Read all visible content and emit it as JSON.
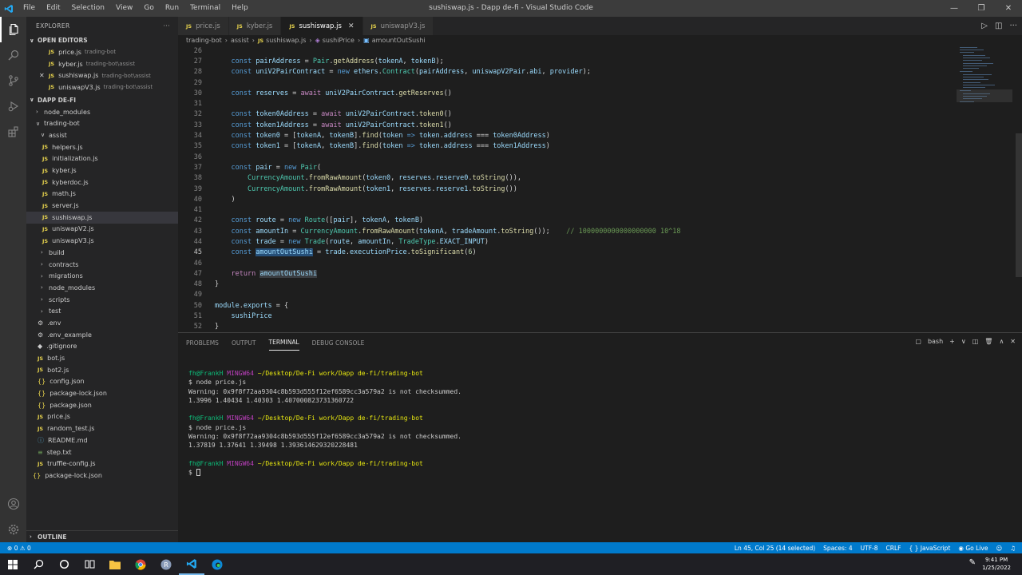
{
  "window": {
    "title": "sushiswap.js - Dapp de-fi - Visual Studio Code",
    "menu": [
      "File",
      "Edit",
      "Selection",
      "View",
      "Go",
      "Run",
      "Terminal",
      "Help"
    ]
  },
  "sidebar": {
    "title": "EXPLORER",
    "open_editors_label": "OPEN EDITORS",
    "open_editors": [
      {
        "name": "price.js",
        "path": "trading-bot"
      },
      {
        "name": "kyber.js",
        "path": "trading-bot\\assist"
      },
      {
        "name": "sushiswap.js",
        "path": "trading-bot\\assist"
      },
      {
        "name": "uniswapV3.js",
        "path": "trading-bot\\assist"
      }
    ],
    "project_label": "DAPP DE-FI",
    "tree": {
      "node_modules": "node_modules",
      "trading_bot": "trading-bot",
      "assist": "assist",
      "assist_files": [
        "helpers.js",
        "initialization.js",
        "kyber.js",
        "kyberdoc.js",
        "math.js",
        "server.js",
        "sushiswap.js",
        "uniswapV2.js",
        "uniswapV3.js"
      ],
      "folders": [
        "build",
        "contracts",
        "migrations",
        "node_modules",
        "scripts",
        "test"
      ],
      "files": {
        "env": ".env",
        "env_example": ".env_example",
        "gitignore": ".gitignore",
        "bot": "bot.js",
        "bot2": "bot2.js",
        "config": "config.json",
        "package_lock": "package-lock.json",
        "package": "package.json",
        "price": "price.js",
        "random_test": "random_test.js",
        "readme": "README.md",
        "step": "step.txt",
        "truffle": "truffle-config.js"
      },
      "root_package_lock": "package-lock.json"
    },
    "outline_label": "OUTLINE"
  },
  "tabs": [
    {
      "label": "price.js"
    },
    {
      "label": "kyber.js"
    },
    {
      "label": "sushiswap.js"
    },
    {
      "label": "uniswapV3.js"
    }
  ],
  "breadcrumb": [
    "trading-bot",
    "assist",
    "sushiswap.js",
    "sushiPrice",
    "amountOutSushi"
  ],
  "editor": {
    "line_numbers": [
      "26",
      "27",
      "28",
      "29",
      "30",
      "31",
      "32",
      "33",
      "34",
      "35",
      "36",
      "37",
      "38",
      "39",
      "40",
      "41",
      "42",
      "43",
      "44",
      "45",
      "46",
      "47",
      "48",
      "49",
      "50",
      "51",
      "52"
    ],
    "comment": "// 1000000000000000000 10^18",
    "number_0": "0",
    "number_1": "1",
    "number_6": "6"
  },
  "panel": {
    "tabs": [
      "PROBLEMS",
      "OUTPUT",
      "TERMINAL",
      "DEBUG CONSOLE"
    ],
    "shell": "bash",
    "prompt_user": "fh@FrankH",
    "prompt_host": "MINGW64",
    "prompt_path": "~/Desktop/De-Fi work/Dapp de-fi/trading-bot",
    "cmd": "$ node price.js",
    "warning": "Warning: 0x9f8f72aa9304c8b593d555f12ef6589cc3a579a2 is not checksummed.",
    "output1": "1.3996 1.40434 1.40303 1.407000823731360722",
    "output2": "1.37819 1.37641 1.39498 1.393614629320228481",
    "final_prompt": "$"
  },
  "status": {
    "errors": "0",
    "warnings": "0",
    "position": "Ln 45, Col 25 (14 selected)",
    "spaces": "Spaces: 4",
    "encoding": "UTF-8",
    "eol": "CRLF",
    "language": "JavaScript",
    "golive": "Go Live"
  },
  "taskbar": {
    "time": "9:41 PM",
    "date": "1/25/2022"
  },
  "colors": {
    "accent": "#007acc",
    "activity_bar": "#333333",
    "sidebar": "#252526",
    "editor": "#1e1e1e"
  }
}
